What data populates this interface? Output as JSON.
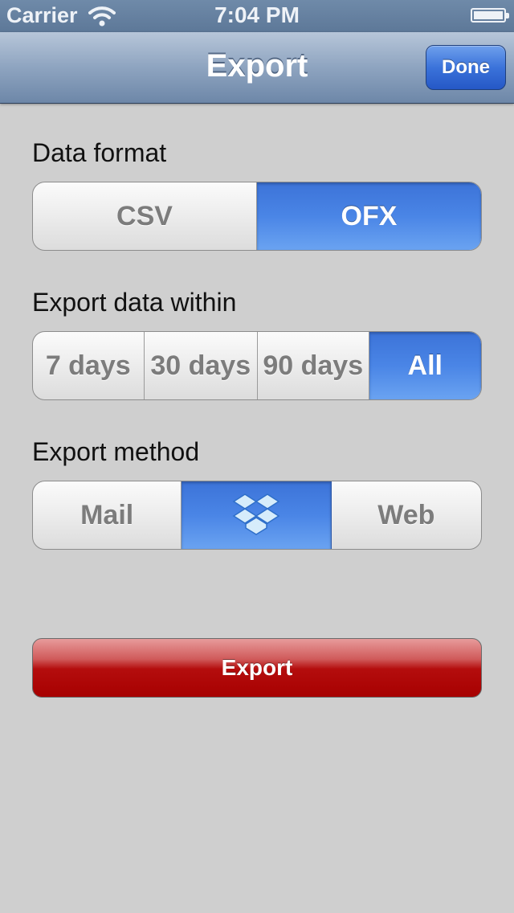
{
  "status_bar": {
    "carrier": "Carrier",
    "time": "7:04 PM",
    "battery_level": 1.0
  },
  "nav": {
    "title": "Export",
    "done_label": "Done"
  },
  "data_format": {
    "label": "Data format",
    "options": [
      "CSV",
      "OFX"
    ],
    "selected": "OFX"
  },
  "export_range": {
    "label": "Export data within",
    "options": [
      "7 days",
      "30 days",
      "90 days",
      "All"
    ],
    "selected": "All"
  },
  "export_method": {
    "label": "Export method",
    "options": [
      "Mail",
      "dropbox-icon",
      "Web"
    ],
    "selected": "dropbox-icon"
  },
  "export_button_label": "Export",
  "colors": {
    "nav_bar": "#8ea4c0",
    "selected_segment": "#4a85e6",
    "export_button": "#b40d0d",
    "background": "#cfcfcf"
  }
}
